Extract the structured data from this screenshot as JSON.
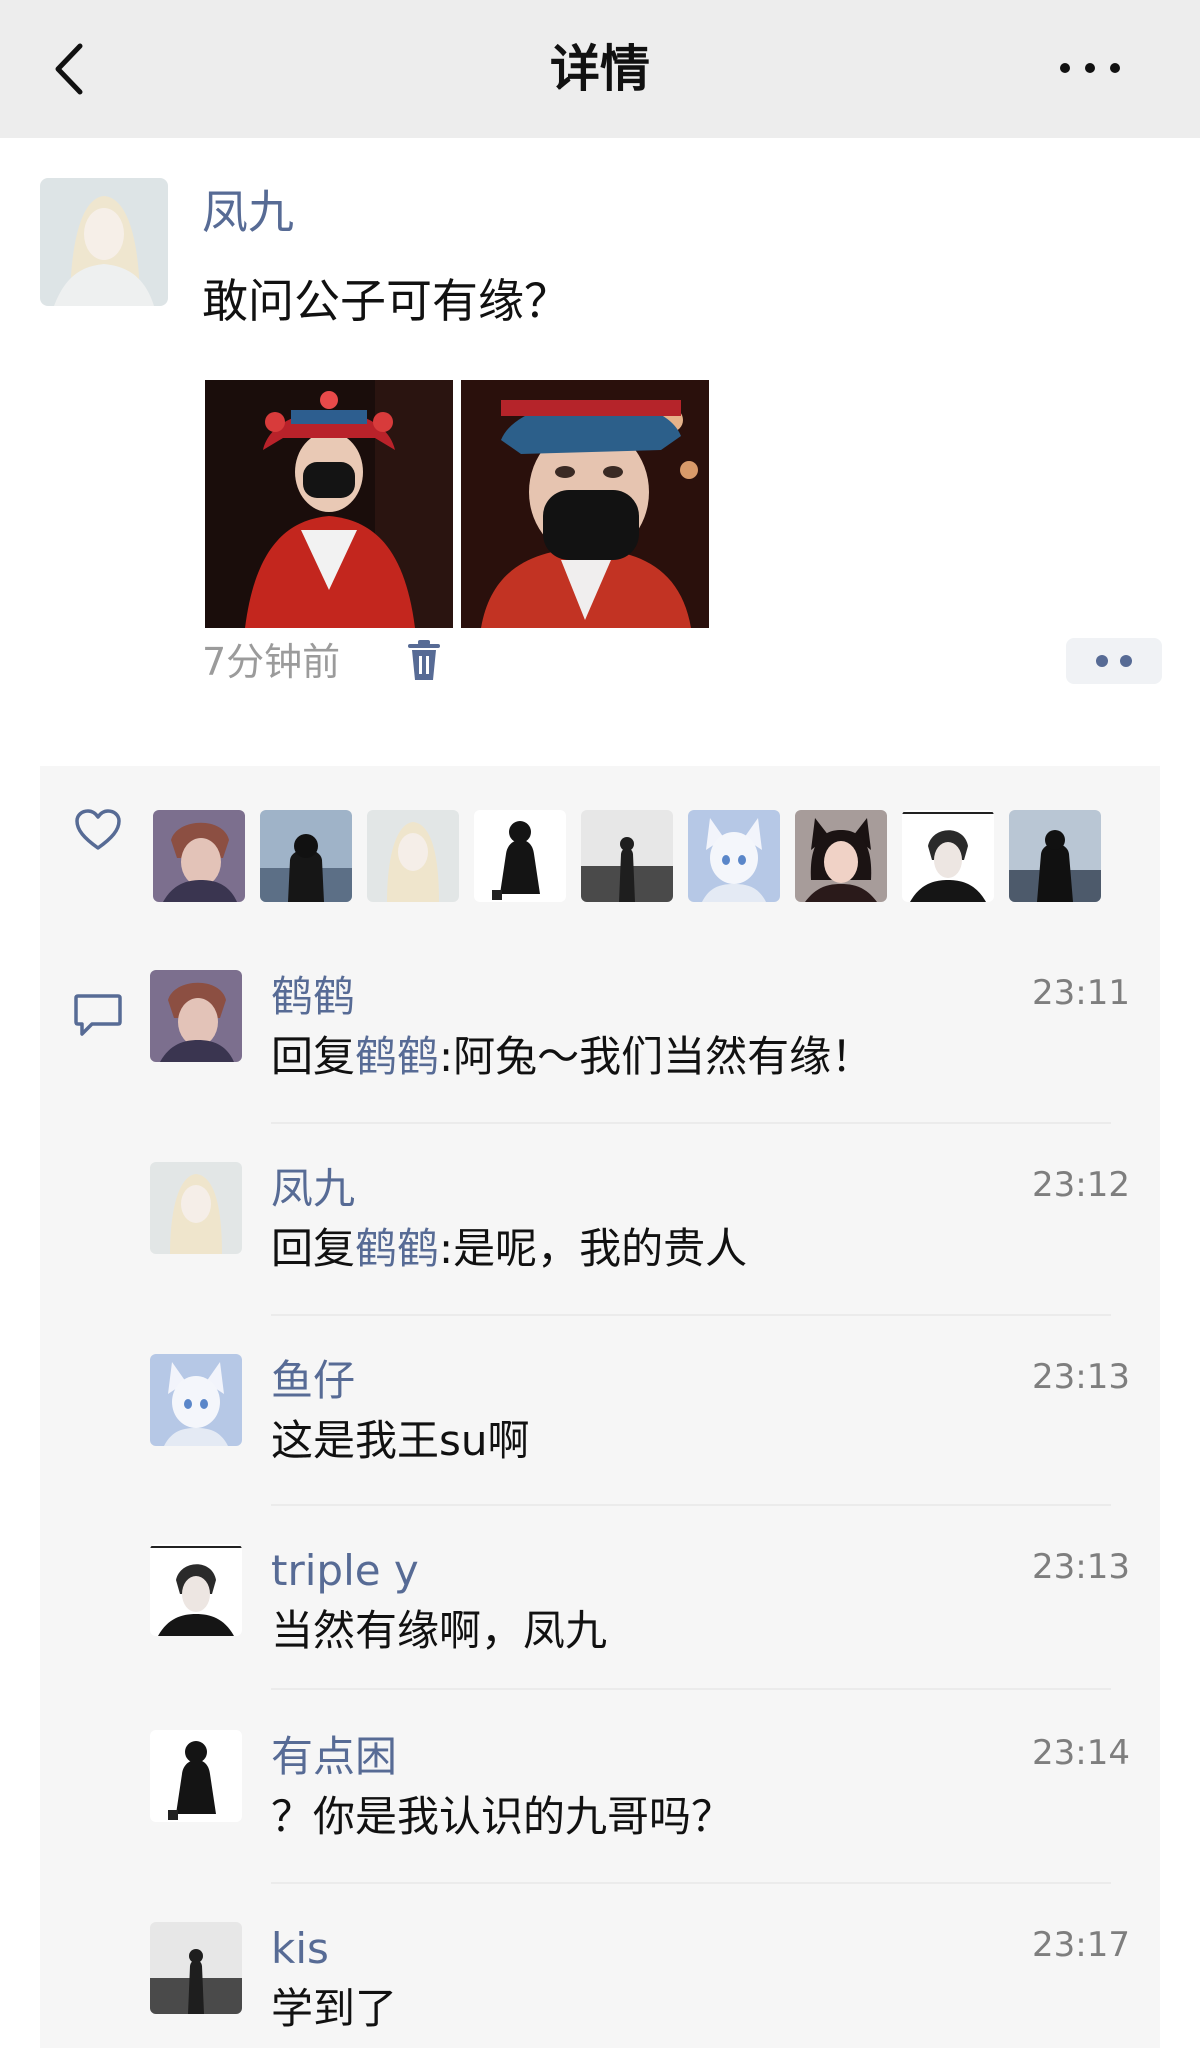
{
  "header": {
    "title": "详情",
    "back_icon": "chevron-left-icon",
    "more_icon": "more-horizontal-icon"
  },
  "post": {
    "author": "凤九",
    "text": "敢问公子可有缘？",
    "time": "7分钟前",
    "photos": [
      "photo-red-costume-1",
      "photo-red-costume-2"
    ],
    "delete_icon": "trash-icon",
    "action_icon": "more-dots-icon"
  },
  "likes": {
    "icon": "heart-icon",
    "avatar_count": 9
  },
  "comments": [
    {
      "name": "鹤鹤",
      "time": "23:11",
      "reply_prefix": "回复",
      "reply_to": "鹤鹤",
      "text": ":阿兔～我们当然有缘！"
    },
    {
      "name": "凤九",
      "time": "23:12",
      "reply_prefix": "回复",
      "reply_to": "鹤鹤",
      "text": ":是呢，我的贵人"
    },
    {
      "name": "鱼仔",
      "time": "23:13",
      "text": "这是我王su啊"
    },
    {
      "name": "triple y",
      "time": "23:13",
      "text": "当然有缘啊，凤九"
    },
    {
      "name": "有点困",
      "time": "23:14",
      "text": "？你是我认识的九哥吗？"
    },
    {
      "name": "kis",
      "time": "23:17",
      "text": "学到了"
    }
  ],
  "colors": {
    "link_blue": "#576b95",
    "header_bg": "#ededed",
    "panel_bg": "#f6f6f6",
    "meta_gray": "#9b9b9b"
  }
}
